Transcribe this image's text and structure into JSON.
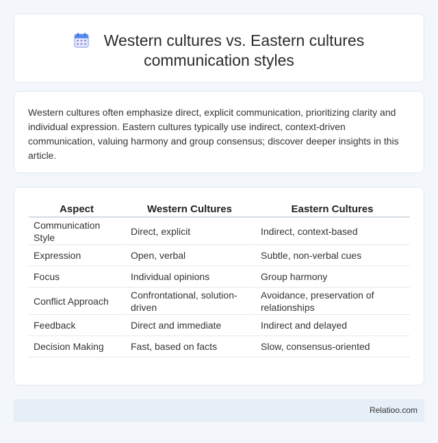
{
  "header": {
    "icon": "calendar-icon",
    "title_line1": "Western cultures vs. Eastern cultures",
    "title_line2": "communication styles"
  },
  "summary": {
    "text": "Western cultures often emphasize direct, explicit communication, prioritizing clarity and individual expression. Eastern cultures typically use indirect, context-driven communication, valuing harmony and group consensus; discover deeper insights in this article."
  },
  "table": {
    "headers": [
      "Aspect",
      "Western Cultures",
      "Eastern Cultures"
    ],
    "rows": [
      [
        "Communication Style",
        "Direct, explicit",
        "Indirect, context-based"
      ],
      [
        "Expression",
        "Open, verbal",
        "Subtle, non-verbal cues"
      ],
      [
        "Focus",
        "Individual opinions",
        "Group harmony"
      ],
      [
        "Conflict Approach",
        "Confrontational, solution-driven",
        "Avoidance, preservation of relationships"
      ],
      [
        "Feedback",
        "Direct and immediate",
        "Indirect and delayed"
      ],
      [
        "Decision Making",
        "Fast, based on facts",
        "Slow, consensus-oriented"
      ]
    ]
  },
  "footer": {
    "site": "Relatioo.com"
  }
}
